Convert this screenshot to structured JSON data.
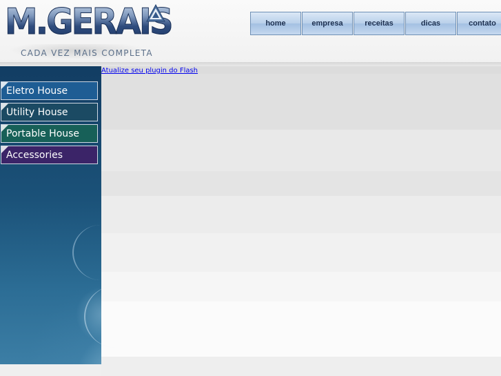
{
  "logo": {
    "wordmark": "M.GERAIS",
    "tagline": "CADA VEZ MAIS COMPLETA"
  },
  "topnav": {
    "items": [
      {
        "label": "home"
      },
      {
        "label": "empresa"
      },
      {
        "label": "receitas"
      },
      {
        "label": "dicas"
      },
      {
        "label": "contato"
      }
    ]
  },
  "sidebar": {
    "items": [
      {
        "label": "Eletro House",
        "color": "#1e5d94"
      },
      {
        "label": "Utility House",
        "color": "#1b4a63"
      },
      {
        "label": "Portable House",
        "color": "#176058"
      },
      {
        "label": "Accessories",
        "color": "#3b2468"
      }
    ]
  },
  "content": {
    "flash_notice": "Atualize seu plugin do Flash"
  },
  "colors": {
    "nav_border": "#6e8fb4",
    "nav_text": "#1c2f4f",
    "link": "#0000ee"
  }
}
